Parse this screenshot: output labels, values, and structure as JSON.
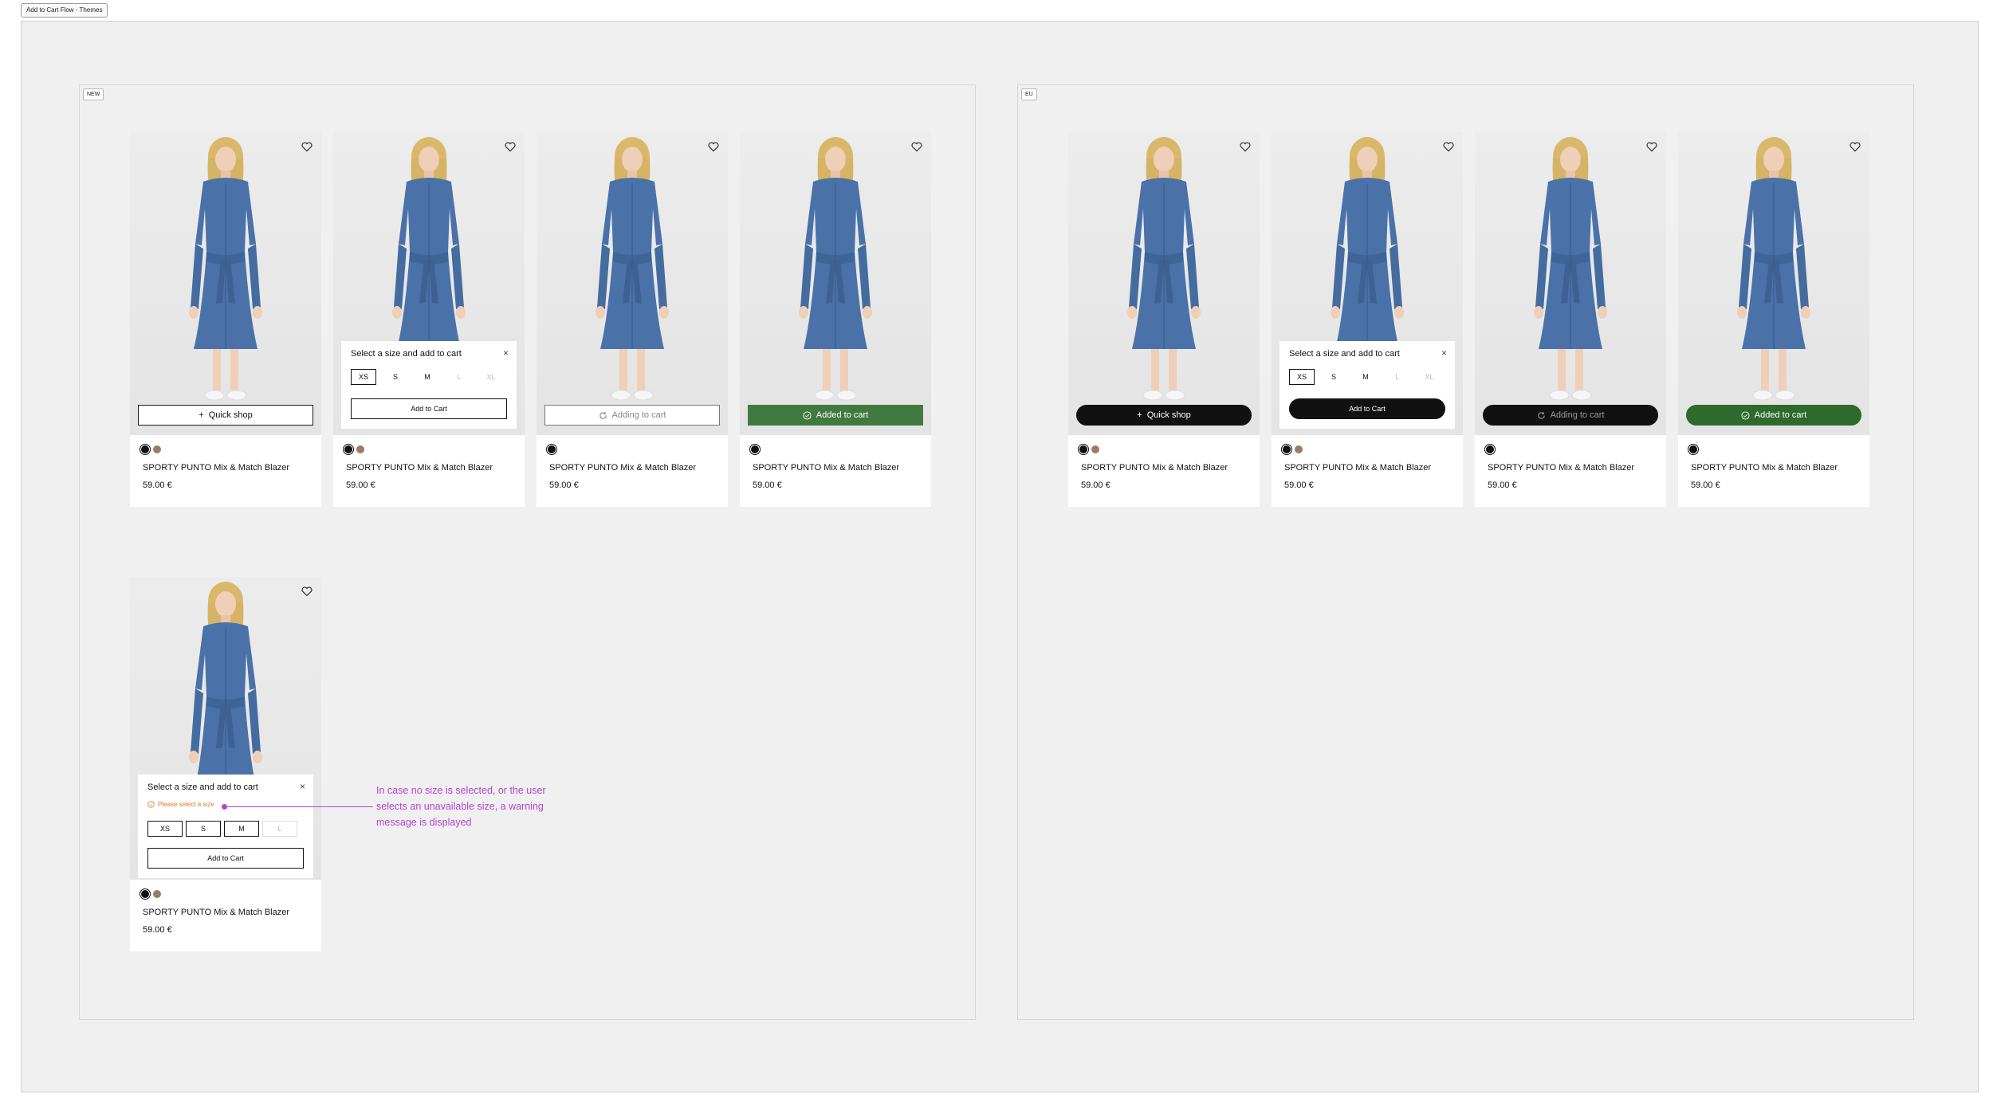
{
  "page_tag": "Add to Cart Flow - Themes",
  "sections": {
    "new_label": "NEW",
    "eu_label": "EU"
  },
  "product": {
    "name": "SPORTY PUNTO Mix & Match Blazer",
    "price": "59.00 €"
  },
  "buttons": {
    "quick_shop": "Quick shop",
    "adding": "Adding to cart",
    "added": "Added to cart",
    "add_to_cart": "Add to Cart"
  },
  "popup": {
    "title": "Select a size and add to cart",
    "close": "×",
    "sizes": [
      "XS",
      "S",
      "M",
      "L",
      "XL"
    ],
    "warning": "Please select a size"
  },
  "annotation": "In case no size is selected, or the user selects an unavailable size, a warning message is displayed",
  "colors": {
    "added_green": "#417a3e",
    "eu_added_green": "#2d6a2c",
    "warning_orange": "#e0762c",
    "annotation_purple": "#b245d6"
  }
}
